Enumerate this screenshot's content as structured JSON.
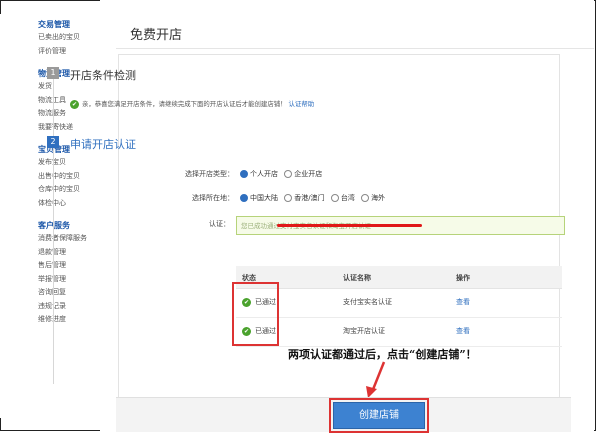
{
  "sidebar": {
    "groups": [
      {
        "title": "交易管理",
        "items": [
          "已卖出的宝贝",
          "评价管理"
        ]
      },
      {
        "title": "物流管理",
        "items": [
          "发货",
          "物流工具",
          "物流服务",
          "我要寄快递"
        ]
      },
      {
        "title": "宝贝管理",
        "items": [
          "发布宝贝",
          "出售中的宝贝",
          "仓库中的宝贝",
          "体检中心"
        ]
      },
      {
        "title": "客户服务",
        "items": [
          "消费者保障服务",
          "退款管理",
          "售后管理",
          "举报管理",
          "咨询回复",
          "违规记录",
          "维修进度"
        ]
      }
    ]
  },
  "main": {
    "title": "免费开店",
    "step1": {
      "number": "1",
      "title": "开店条件检测",
      "hint": "亲，恭喜您满足开店条件，请继续完成下面的开店认证后才能创建店铺！",
      "hint_link": "认证帮助",
      "ok_icon": "✔"
    },
    "step2": {
      "number": "2",
      "title": "申请开店认证",
      "shop_type_label": "选择开店类型：",
      "shop_type_options": [
        "个人开店",
        "企业开店"
      ],
      "location_label": "选择所在地：",
      "location_options": [
        "中国大陆",
        "香港/澳门",
        "台湾",
        "海外"
      ],
      "auth_label": "认证：",
      "auth_text": "您已成功通过支付宝实名认证和淘宝开店认证"
    },
    "table": {
      "headers": [
        "状态",
        "认证名称",
        "操作"
      ],
      "rows": [
        {
          "status": "已通过",
          "name": "支付宝实名认证",
          "action": "查看"
        },
        {
          "status": "已通过",
          "name": "淘宝开店认证",
          "action": "查看"
        }
      ],
      "pass_icon": "✔"
    },
    "annotation": "两项认证都通过后，点击“创建店铺”！",
    "create_button": "创建店铺"
  },
  "colors": {
    "accent": "#2f6fbf",
    "success": "#4aa22d",
    "highlight": "#d33"
  }
}
